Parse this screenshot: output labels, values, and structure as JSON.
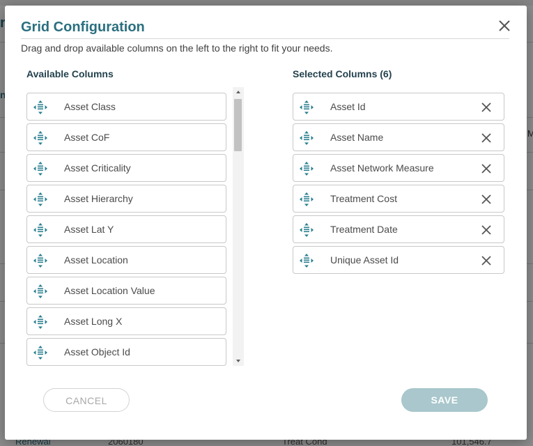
{
  "background": {
    "left_fragment": "r",
    "left_fragment2": "n",
    "right_fragment": "M",
    "bottom_left": "Renewal",
    "bottom_mid": "2060180",
    "bottom_mid2": "Treat Cond",
    "bottom_right": "101,546.7"
  },
  "modal": {
    "title": "Grid Configuration",
    "description": "Drag and drop available columns on the left to the right to fit your needs.",
    "available_heading": "Available Columns",
    "selected_heading": "Selected Columns (6)",
    "available_columns": [
      "Asset Class",
      "Asset CoF",
      "Asset Criticality",
      "Asset Hierarchy",
      "Asset Lat Y",
      "Asset Location",
      "Asset Location Value",
      "Asset Long X",
      "Asset Object Id"
    ],
    "selected_columns": [
      "Asset Id",
      "Asset Name",
      "Asset Network Measure",
      "Treatment Cost",
      "Treatment Date",
      "Unique Asset Id"
    ],
    "cancel_label": "CANCEL",
    "save_label": "SAVE"
  },
  "icons": {
    "close": "close-icon",
    "drag": "drag-handle-icon",
    "remove": "remove-icon",
    "scroll_up": "scroll-up-arrow-icon",
    "scroll_down": "scroll-down-arrow-icon"
  },
  "colors": {
    "title": "#2a6f7f",
    "drag_icon": "#2a7f8f",
    "save_button": "#a9c7cc",
    "cancel_text": "#a8a8a8"
  }
}
